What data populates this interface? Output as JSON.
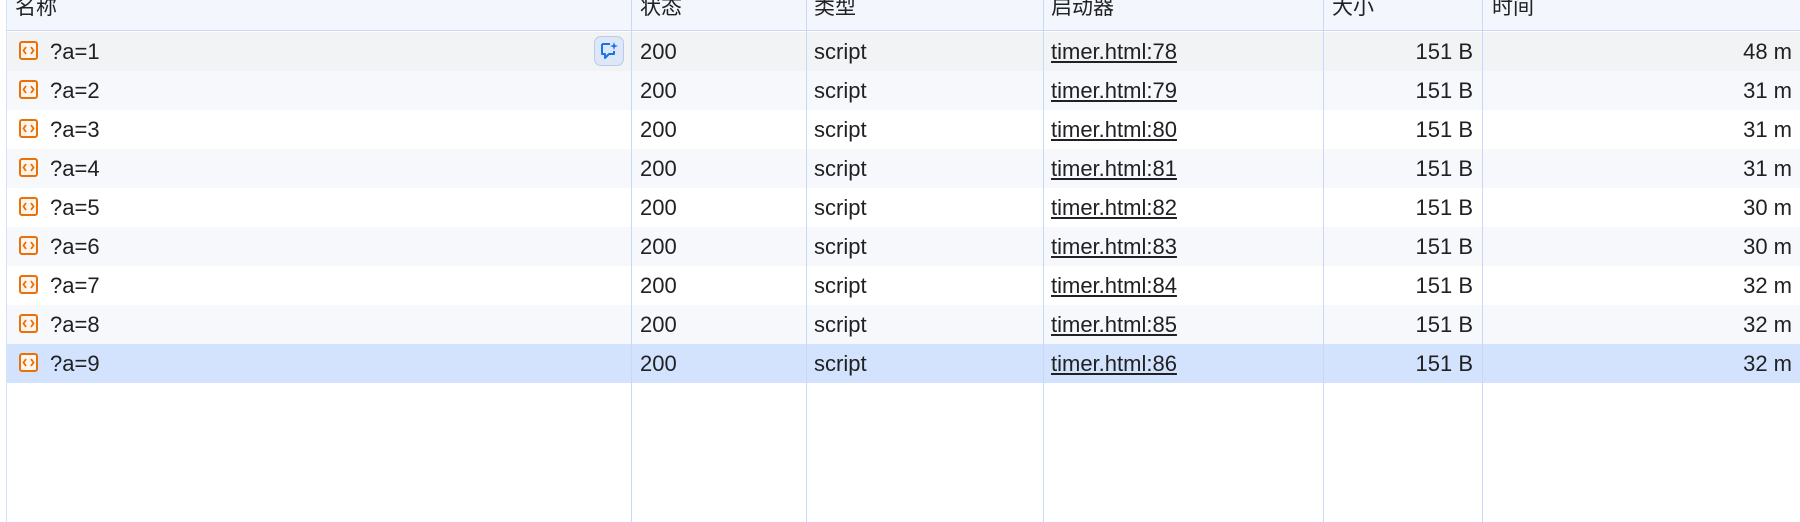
{
  "columns": {
    "name": "名称",
    "status": "状态",
    "type": "类型",
    "initiator": "启动器",
    "size": "大小",
    "time": "时间"
  },
  "rows": [
    {
      "name": "?a=1",
      "status": "200",
      "type": "script",
      "initiator": "timer.html:78",
      "size": "151 B",
      "time": "48 m"
    },
    {
      "name": "?a=2",
      "status": "200",
      "type": "script",
      "initiator": "timer.html:79",
      "size": "151 B",
      "time": "31 m"
    },
    {
      "name": "?a=3",
      "status": "200",
      "type": "script",
      "initiator": "timer.html:80",
      "size": "151 B",
      "time": "31 m"
    },
    {
      "name": "?a=4",
      "status": "200",
      "type": "script",
      "initiator": "timer.html:81",
      "size": "151 B",
      "time": "31 m"
    },
    {
      "name": "?a=5",
      "status": "200",
      "type": "script",
      "initiator": "timer.html:82",
      "size": "151 B",
      "time": "30 m"
    },
    {
      "name": "?a=6",
      "status": "200",
      "type": "script",
      "initiator": "timer.html:83",
      "size": "151 B",
      "time": "30 m"
    },
    {
      "name": "?a=7",
      "status": "200",
      "type": "script",
      "initiator": "timer.html:84",
      "size": "151 B",
      "time": "32 m"
    },
    {
      "name": "?a=8",
      "status": "200",
      "type": "script",
      "initiator": "timer.html:85",
      "size": "151 B",
      "time": "32 m"
    },
    {
      "name": "?a=9",
      "status": "200",
      "type": "script",
      "initiator": "timer.html:86",
      "size": "151 B",
      "time": "32 m"
    }
  ],
  "hovered_row": 0,
  "selected_row": 8,
  "icons": {
    "file": "script-file-icon",
    "ai_assist": "ai-assistance-icon"
  },
  "colors": {
    "accent": "#e8710a",
    "selected_row": "#d3e3fd",
    "grid_line": "#c7d9f7"
  }
}
